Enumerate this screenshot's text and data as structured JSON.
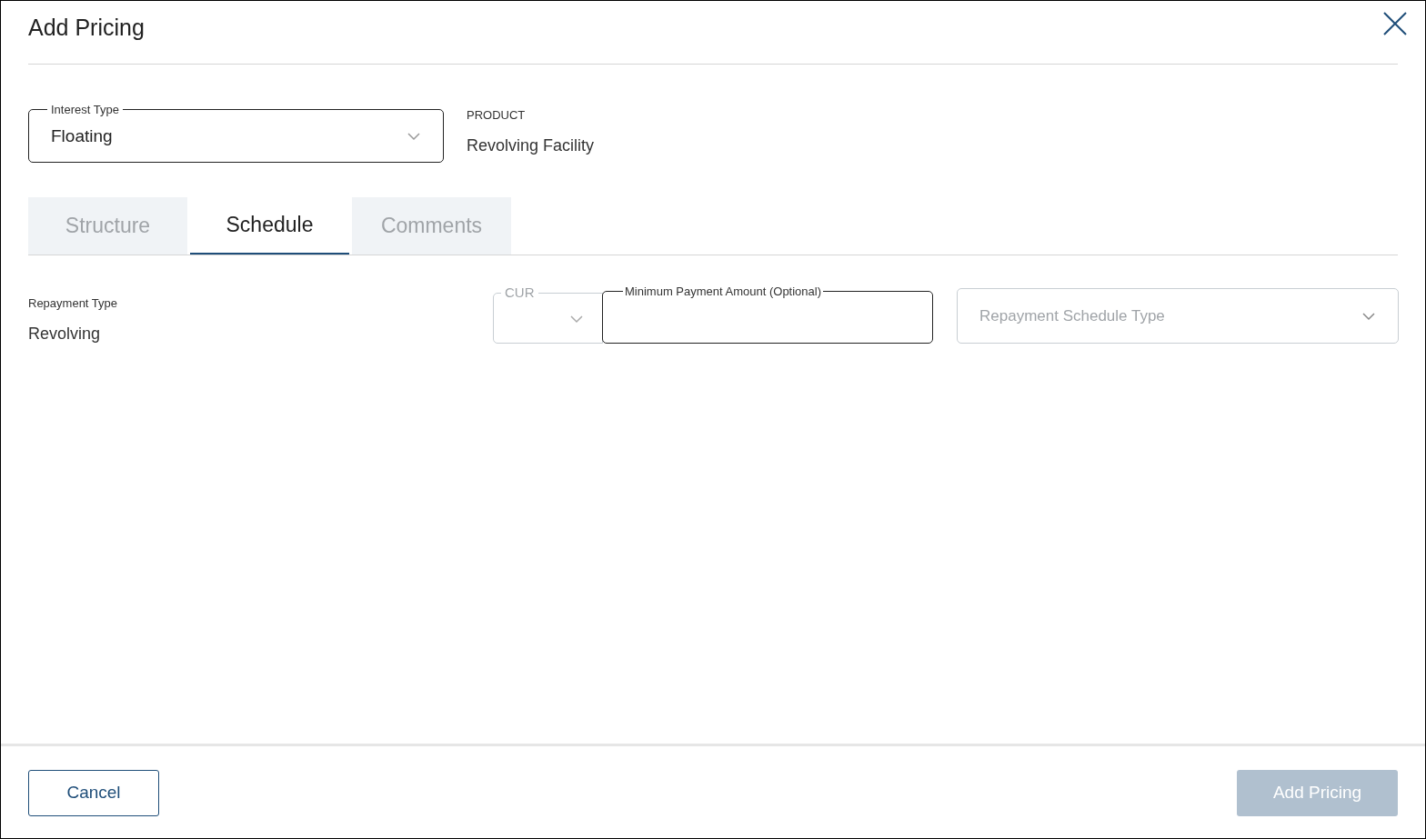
{
  "dialog": {
    "title": "Add Pricing"
  },
  "interest_type": {
    "label": "Interest Type",
    "value": "Floating"
  },
  "product": {
    "label": "PRODUCT",
    "value": "Revolving Facility"
  },
  "tabs": [
    {
      "label": "Structure",
      "selected": false
    },
    {
      "label": "Schedule",
      "selected": true
    },
    {
      "label": "Comments",
      "selected": false
    }
  ],
  "repayment_type": {
    "label": "Repayment Type",
    "value": "Revolving"
  },
  "currency": {
    "label": "CUR",
    "disabled": true
  },
  "minimum_payment": {
    "label": "Minimum Payment Amount (Optional)"
  },
  "repayment_schedule_type": {
    "placeholder": "Repayment Schedule Type",
    "disabled": true
  },
  "buttons": [
    {
      "label": "Cancel",
      "kind": "secondary",
      "disabled": false
    },
    {
      "label": "Add Pricing",
      "kind": "primary",
      "disabled": true
    }
  ]
}
